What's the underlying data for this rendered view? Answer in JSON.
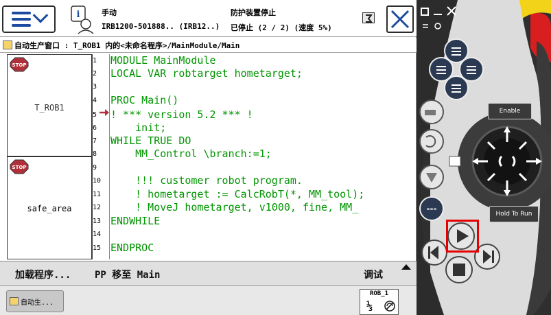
{
  "topbar": {
    "mode": "手动",
    "controller": "IRB1200-501888.. (IRB12..)",
    "safety": "防护装置停止",
    "run_state": "已停止 (2 / 2) (速度 5%)"
  },
  "window": {
    "title": "自动生产窗口 : T_ROB1 内的<未命名程序>/MainModule/Main"
  },
  "tasks": [
    {
      "name": "T_ROB1",
      "state": "STOP"
    },
    {
      "name": "safe_area",
      "state": "STOP"
    }
  ],
  "code": {
    "line_numbers": [
      "1",
      "2",
      "3",
      "4",
      "5",
      "6",
      "7",
      "8",
      "9",
      "10",
      "11",
      "12",
      "13",
      "14",
      "15"
    ],
    "lines": [
      "MODULE MainModule",
      "LOCAL VAR robtarget hometarget;",
      "",
      "PROC Main()",
      "! *** version 5.2 *** !",
      "    init;",
      "WHILE TRUE DO",
      "    MM_Control \\branch:=1;",
      "",
      "    !!! customer robot program.",
      "    ! hometarget := CalcRobT(*, MM_tool);",
      "    ! MoveJ hometarget, v1000, fine, MM_",
      "ENDWHILE",
      "",
      "ENDPROC"
    ],
    "program_pointer_line": 5
  },
  "commandbar": {
    "load": "加载程序...",
    "pp_to_main": "PP 移至 Main",
    "debug": "调试"
  },
  "taskbar": {
    "window_button": "自动生..."
  },
  "quickset": {
    "mechanical_unit": "ROB_1",
    "increment": "⅓"
  },
  "hardware": {
    "enable_label": "Enable",
    "hold_to_run_label": "Hold To Run"
  },
  "colors": {
    "code_green": "#009500",
    "stop_red": "#b0303a",
    "highlight_red": "#e60000",
    "hardware_dark": "#2f2f2f",
    "guard_yellow": "#f3d21a"
  }
}
